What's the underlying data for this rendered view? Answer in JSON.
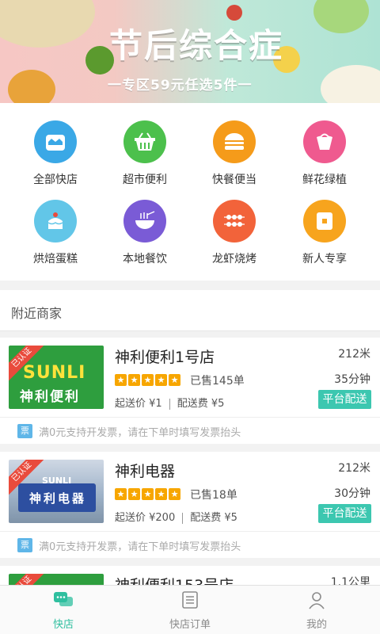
{
  "banner": {
    "title": "节后综合症",
    "subtitle": "一专区59元任选5件一",
    "colors": {
      "left": "#f6c7c4",
      "right": "#aee3d4"
    }
  },
  "categories": [
    {
      "label": "全部快店",
      "icon": "store-icon",
      "color": "#3aa8e6"
    },
    {
      "label": "超市便利",
      "icon": "basket-icon",
      "color": "#4cc04c"
    },
    {
      "label": "快餐便当",
      "icon": "burger-icon",
      "color": "#f59b1a"
    },
    {
      "label": "鲜花绿植",
      "icon": "flower-icon",
      "color": "#ef5a8f"
    },
    {
      "label": "烘焙蛋糕",
      "icon": "cake-icon",
      "color": "#62c6e8"
    },
    {
      "label": "本地餐饮",
      "icon": "noodle-bowl-icon",
      "color": "#7a5bd6"
    },
    {
      "label": "龙虾烧烤",
      "icon": "skewer-icon",
      "color": "#f2633a"
    },
    {
      "label": "新人专享",
      "icon": "gift-card-icon",
      "color": "#f7a41d"
    }
  ],
  "section": {
    "title": "附近商家"
  },
  "stores": [
    {
      "name": "神利便利1号店",
      "distance": "212米",
      "time": "35分钟",
      "sold": "已售145单",
      "min_order": "起送价 ¥1",
      "delivery_fee": "配送费 ¥5",
      "badge": "平台配送",
      "verified": "已认证",
      "invoice": "满0元支持开发票，请在下单时填写发票抬头",
      "invoice_icon": "票",
      "thumb_brand": "SUNLI",
      "thumb_text": "神利便利"
    },
    {
      "name": "神利电器",
      "distance": "212米",
      "time": "30分钟",
      "sold": "已售18单",
      "min_order": "起送价 ¥200",
      "delivery_fee": "配送费 ¥5",
      "badge": "平台配送",
      "verified": "已认证",
      "invoice": "满0元支持开发票，请在下单时填写发票抬头",
      "invoice_icon": "票",
      "thumb_brand": "SUNLI",
      "thumb_text": "神利电器"
    },
    {
      "name": "神利便利153号店",
      "distance": "1.1公里",
      "verified": "已认证"
    }
  ],
  "tabbar": [
    {
      "label": "快店",
      "icon": "chat-bubbles-icon",
      "active": true
    },
    {
      "label": "快店订单",
      "icon": "order-list-icon",
      "active": false
    },
    {
      "label": "我的",
      "icon": "user-icon",
      "active": false
    }
  ],
  "colors": {
    "accent": "#2fbf9f",
    "badge": "#3cc7b0",
    "star": "#f7a600",
    "ribbon": "#e94b3c"
  }
}
